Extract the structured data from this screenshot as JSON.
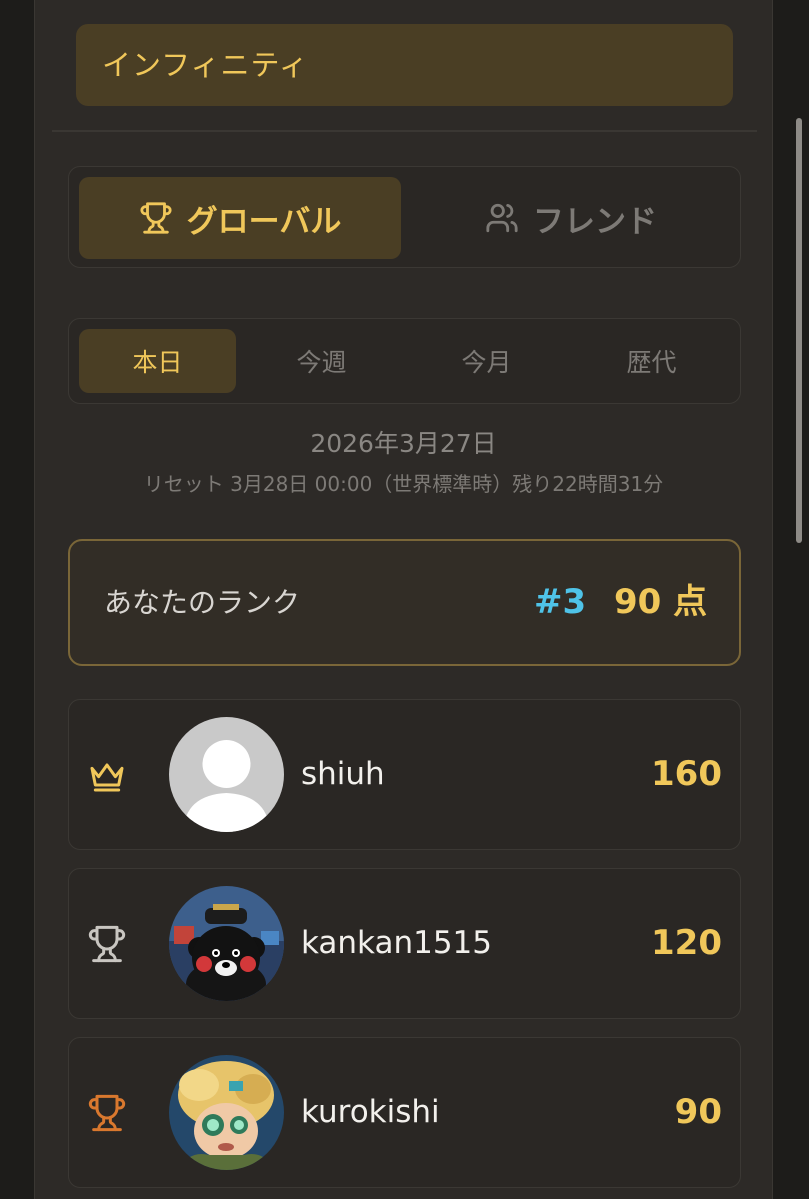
{
  "header": {
    "title": "インフィニティ"
  },
  "scope_tabs": [
    {
      "label": "グローバル",
      "icon": "trophy-icon",
      "active": true
    },
    {
      "label": "フレンド",
      "icon": "users-icon",
      "active": false
    }
  ],
  "period_tabs": [
    {
      "label": "本日",
      "active": true
    },
    {
      "label": "今週",
      "active": false
    },
    {
      "label": "今月",
      "active": false
    },
    {
      "label": "歴代",
      "active": false
    }
  ],
  "date": "2026年3月27日",
  "reset_info": "リセット 3月28日 00:00（世界標準時）残り22時間31分",
  "my_rank": {
    "label": "あなたのランク",
    "position": "#3",
    "score": "90 点"
  },
  "leaderboard": [
    {
      "rank_icon": "crown-icon",
      "username": "shiuh",
      "score": "160",
      "avatar": "default-avatar"
    },
    {
      "rank_icon": "silver-trophy-icon",
      "username": "kankan1515",
      "score": "120",
      "avatar": "bear-mascot-avatar"
    },
    {
      "rank_icon": "bronze-trophy-icon",
      "username": "kurokishi",
      "score": "90",
      "avatar": "character-avatar"
    }
  ],
  "colors": {
    "accent": "#f0c75a",
    "rank_highlight": "#4fc3e8",
    "panel": "#2d2a27",
    "silver": "#c9c6c1",
    "bronze": "#d9782e"
  }
}
